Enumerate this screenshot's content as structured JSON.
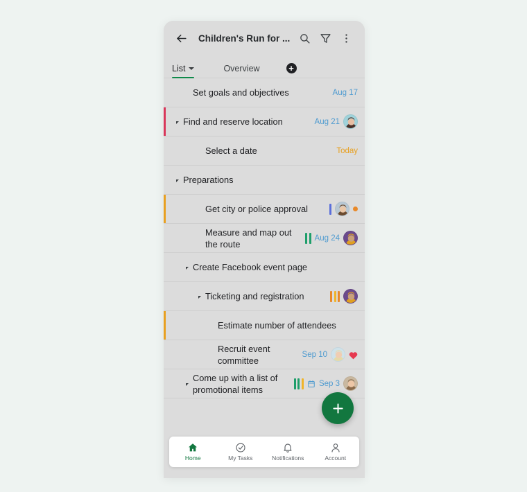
{
  "app": {
    "background_color": "#eef3f1",
    "card_color": "#dcdcdc",
    "accent_green": "#12773f",
    "date_blue": "#4f9bd0",
    "today_orange": "#e8a020"
  },
  "appbar": {
    "back_icon": "arrow-left-icon",
    "title": "Children's Run for ...",
    "search_icon": "search-icon",
    "filter_icon": "filter-funnel-icon",
    "more_icon": "more-vertical-icon"
  },
  "tabs": {
    "items": [
      {
        "label": "List",
        "active": true,
        "has_caret": true
      },
      {
        "label": "Overview",
        "active": false,
        "has_caret": false
      }
    ],
    "add_label": "+"
  },
  "tasks": [
    {
      "label": "Set goals and objectives",
      "indent": 1,
      "disclosure": false,
      "left_bar": null,
      "date": "Aug 17",
      "date_style": "blue",
      "tags": [],
      "avatar": null,
      "dot": null,
      "heart": false,
      "calendar": false
    },
    {
      "label": "Find and reserve location",
      "indent": 0,
      "disclosure": true,
      "left_bar": "#d9365a",
      "date": "Aug 21",
      "date_style": "blue",
      "tags": [],
      "avatar": "avatar-woman-dark-hair",
      "dot": null,
      "heart": false,
      "calendar": false
    },
    {
      "label": "Select a date",
      "indent": 2,
      "disclosure": false,
      "left_bar": null,
      "date": "Today",
      "date_style": "today",
      "tags": [],
      "avatar": null,
      "dot": null,
      "heart": false,
      "calendar": false
    },
    {
      "label": "Preparations",
      "indent": 0,
      "disclosure": true,
      "left_bar": null,
      "date": null,
      "date_style": null,
      "tags": [],
      "avatar": null,
      "dot": null,
      "heart": false,
      "calendar": false
    },
    {
      "label": "Get city or police approval",
      "indent": 2,
      "disclosure": false,
      "left_bar": "#e8a020",
      "date": null,
      "date_style": null,
      "tags": [
        "#5b6fdb"
      ],
      "avatar": "avatar-man-glasses",
      "dot": "#e8892a",
      "heart": false,
      "calendar": false
    },
    {
      "label": "Measure and map out the route",
      "indent": 2,
      "disclosure": false,
      "left_bar": null,
      "date": "Aug 24",
      "date_style": "blue",
      "tags": [
        "#1e9e6a",
        "#1e9e6a"
      ],
      "avatar": "avatar-person-purple",
      "dot": null,
      "heart": false,
      "calendar": false
    },
    {
      "label": "Create Facebook event page",
      "indent": 1,
      "disclosure": true,
      "left_bar": null,
      "date": null,
      "date_style": null,
      "tags": [],
      "avatar": null,
      "dot": null,
      "heart": false,
      "calendar": false
    },
    {
      "label": "Ticketing and registration",
      "indent": 2,
      "disclosure": true,
      "left_bar": null,
      "date": null,
      "date_style": null,
      "tags": [
        "#e8892a",
        "#f0b429",
        "#e8892a"
      ],
      "avatar": "avatar-person-purple",
      "dot": null,
      "heart": false,
      "calendar": false
    },
    {
      "label": "Estimate number of attendees",
      "indent": 3,
      "disclosure": false,
      "left_bar": "#e8a020",
      "date": null,
      "date_style": null,
      "tags": [],
      "avatar": null,
      "dot": null,
      "heart": false,
      "calendar": false
    },
    {
      "label": "Recruit event committee",
      "indent": 3,
      "disclosure": false,
      "left_bar": null,
      "date": "Sep 10",
      "date_style": "blue",
      "tags": [],
      "avatar": "avatar-woman-blonde",
      "dot": null,
      "heart": true,
      "calendar": false
    },
    {
      "label": "Come up with a list of promotional items",
      "indent": 1,
      "disclosure": true,
      "left_bar": null,
      "date": "Sep 3",
      "date_style": "blue",
      "tags": [
        "#1e9e6a",
        "#1e9e6a",
        "#f0b429"
      ],
      "avatar": "avatar-group",
      "dot": null,
      "heart": false,
      "calendar": true
    }
  ],
  "fab": {
    "icon": "plus-icon",
    "label": "+"
  },
  "bottom_nav": {
    "items": [
      {
        "label": "Home",
        "icon": "home-icon",
        "active": true
      },
      {
        "label": "My Tasks",
        "icon": "check-circle-icon",
        "active": false
      },
      {
        "label": "Notifications",
        "icon": "bell-icon",
        "active": false
      },
      {
        "label": "Account",
        "icon": "person-icon",
        "active": false
      }
    ]
  }
}
